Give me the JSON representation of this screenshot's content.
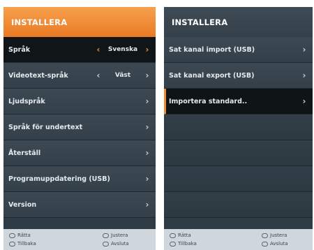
{
  "left": {
    "title": "INSTALLERA",
    "items": [
      {
        "label": "Språk",
        "value": "Svenska"
      },
      {
        "label": "Videotext-språk",
        "value": "Väst"
      },
      {
        "label": "Ljudspråk"
      },
      {
        "label": "Språk för undertext"
      },
      {
        "label": "Återställ"
      },
      {
        "label": "Programuppdatering (USB)"
      },
      {
        "label": "Version"
      }
    ],
    "footer": {
      "ratta": "Rätta",
      "tillbaka": "Tillbaka",
      "justera": "Justera",
      "avsluta": "Avsluta"
    }
  },
  "right": {
    "title": "INSTALLERA",
    "items": [
      {
        "label": "Sat kanal import (USB)"
      },
      {
        "label": "Sat kanal export (USB)"
      },
      {
        "label": "Importera standard.."
      }
    ],
    "footer": {
      "ratta": "Rätta",
      "tillbaka": "Tillbaka",
      "justera": "Justera",
      "avsluta": "Avsluta"
    }
  },
  "colors": {
    "accent": "#f08a30",
    "menu_bg": "#2f3c45",
    "footer_bg": "#cfd7dd"
  },
  "icons": {
    "arrow_left": "‹",
    "arrow_right": "›"
  }
}
